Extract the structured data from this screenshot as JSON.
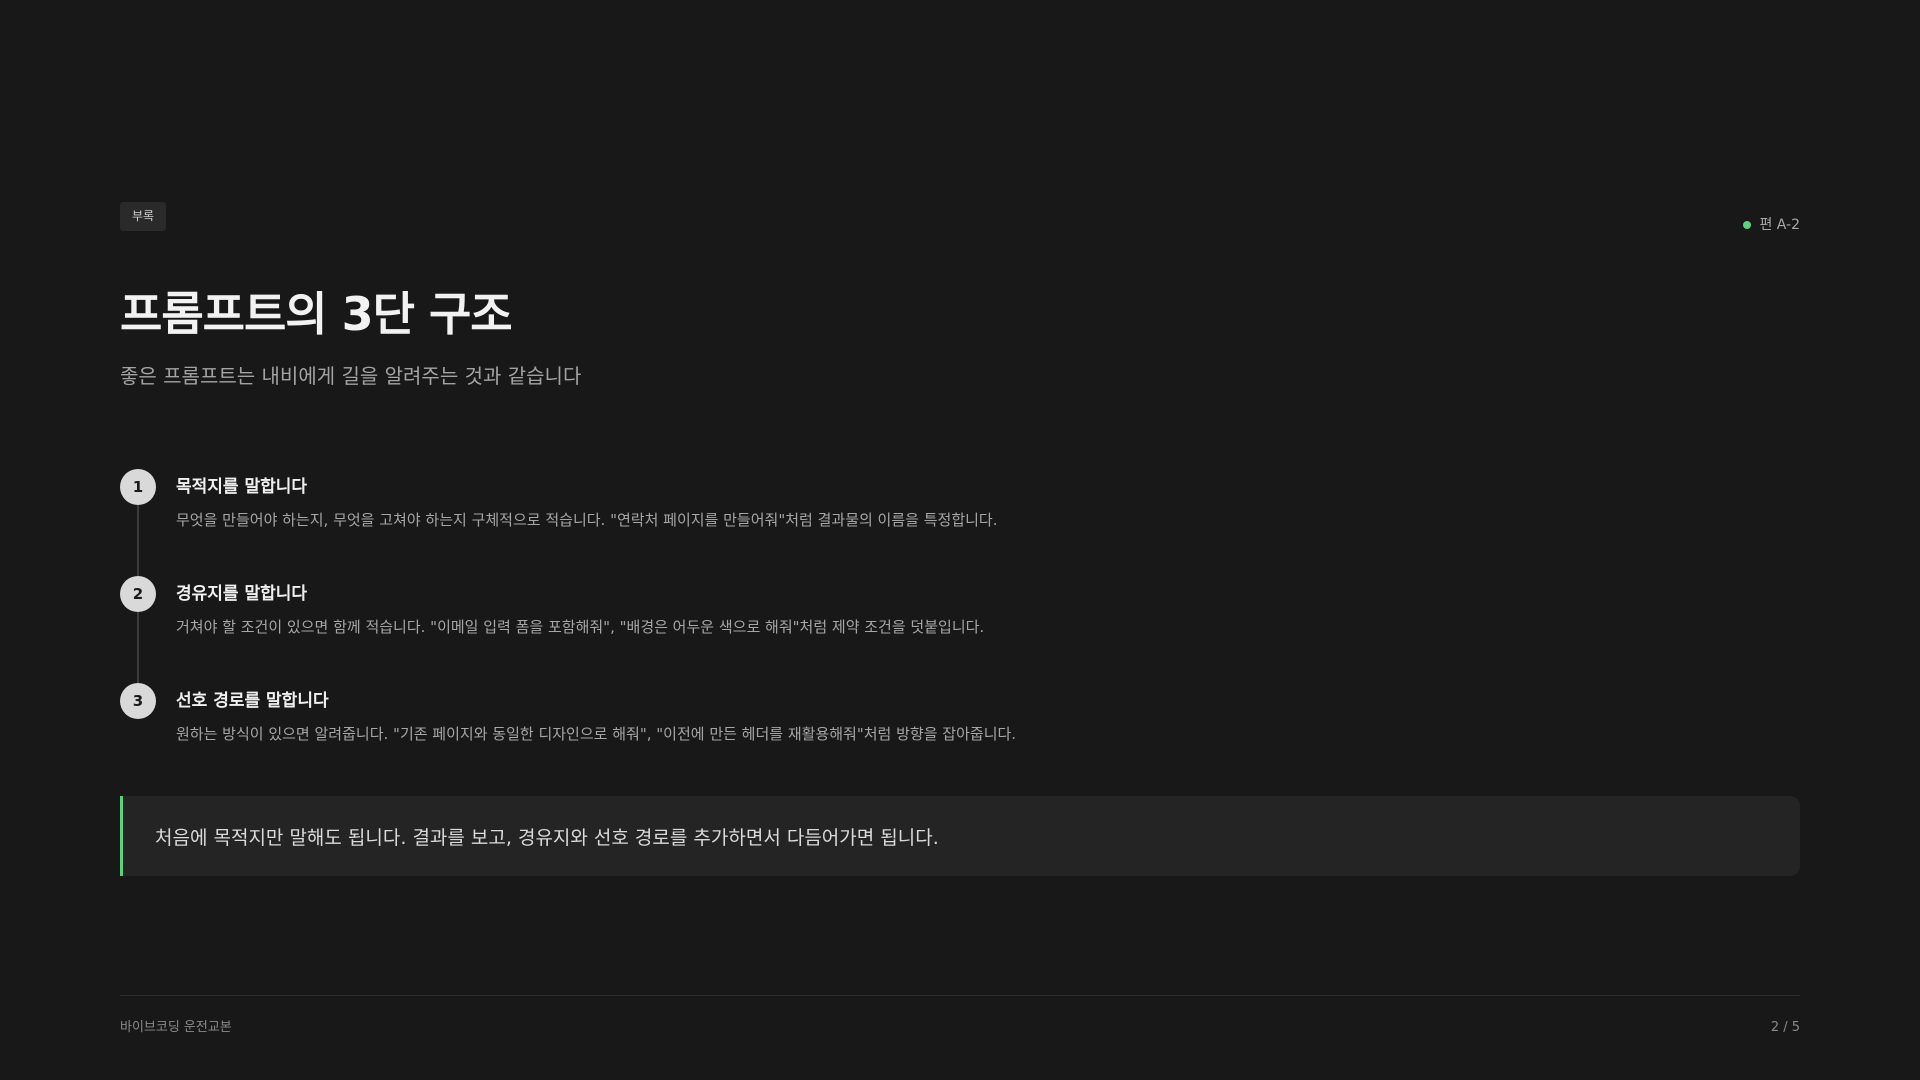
{
  "header": {
    "tag": "부록",
    "episode": "편 A-2",
    "accent_color": "#5fd07e"
  },
  "title": "프롬프트의 3단 구조",
  "subtitle": "좋은 프롬프트는 내비에게 길을 알려주는 것과 같습니다",
  "steps": [
    {
      "number": "1",
      "heading": "목적지를 말합니다",
      "description": "무엇을 만들어야 하는지, 무엇을 고쳐야 하는지 구체적으로 적습니다. \"연락처 페이지를 만들어줘\"처럼 결과물의 이름을 특정합니다."
    },
    {
      "number": "2",
      "heading": "경유지를 말합니다",
      "description": "거쳐야 할 조건이 있으면 함께 적습니다. \"이메일 입력 폼을 포함해줘\", \"배경은 어두운 색으로 해줘\"처럼 제약 조건을 덧붙입니다."
    },
    {
      "number": "3",
      "heading": "선호 경로를 말합니다",
      "description": "원하는 방식이 있으면 알려줍니다. \"기존 페이지와 동일한 디자인으로 해줘\", \"이전에 만든 헤더를 재활용해줘\"처럼 방향을 잡아줍니다."
    }
  ],
  "callout": "처음에 목적지만 말해도 됩니다. 결과를 보고, 경유지와 선호 경로를 추가하면서 다듬어가면 됩니다.",
  "footer": {
    "left": "바이브코딩 운전교본",
    "page": "2 / 5"
  }
}
